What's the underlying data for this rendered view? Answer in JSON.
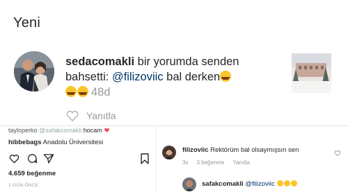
{
  "header": {
    "title": "Yeni"
  },
  "notification": {
    "username": "sedacomakli",
    "text_part1": " bir yorumda senden bahsetti: ",
    "mention": "@filizoviic",
    "text_part2": " bal derken",
    "time": "48d",
    "reply_label": "Yanıtla",
    "emoji": "face-with-tears-of-joy"
  },
  "post_panel": {
    "comment_user": "tayloperko",
    "comment_mention": "@safakcomakli",
    "comment_text": " hocam",
    "caption_user": "hibbebags",
    "caption_text": " Anadolu Üniversitesi",
    "likes": "4.659 beğenme",
    "ago": "1 GÜN ÖNCE",
    "icons": [
      "heart-icon",
      "comment-icon",
      "share-icon",
      "bookmark-icon"
    ]
  },
  "comments_panel": {
    "comment1": {
      "username": "filizoviic",
      "text": " Rektörüm bal olsaymışsın sen",
      "time": "3s",
      "likes": "3 beğenme",
      "reply": "Yanıtla"
    },
    "comment2": {
      "username": "safakcomakli",
      "mention": "@filizoviic"
    }
  },
  "colors": {
    "text": "#262626",
    "muted": "#999999",
    "mention": "#003569",
    "emoji": "#f9c52b"
  }
}
